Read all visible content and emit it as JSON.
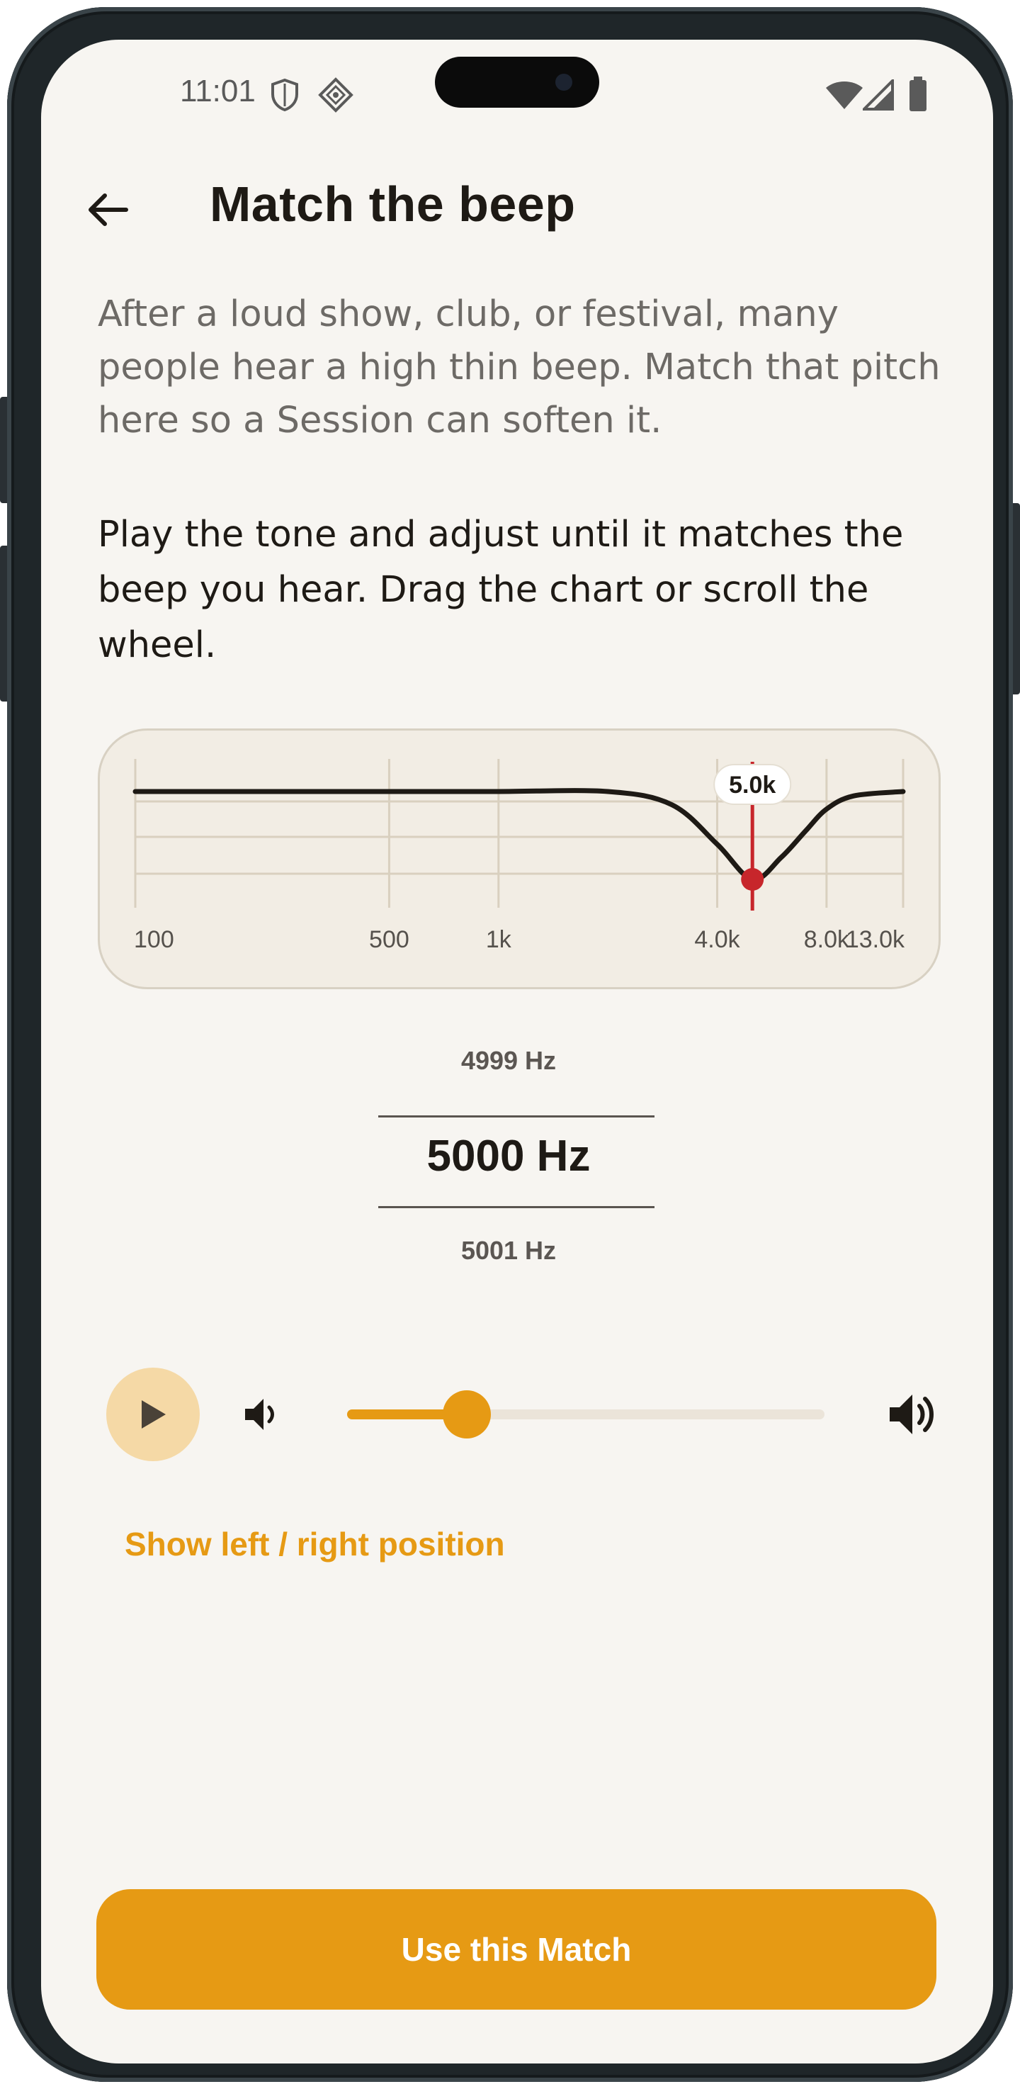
{
  "status_bar": {
    "time": "11:01",
    "icons": [
      "shield-icon",
      "location-diamond-icon",
      "wifi-icon",
      "signal-icon",
      "battery-icon"
    ]
  },
  "header": {
    "title": "Match the beep",
    "back_icon": "arrow-left-icon"
  },
  "intro_text": "After a loud show, club, or festival, many people hear a high thin beep. Match that pitch here so a Session can soften it.",
  "instructions_text": "Play the tone and adjust until it matches the beep you hear. Drag the chart or scroll the wheel.",
  "chart_data": {
    "type": "line",
    "x_scale": "log",
    "x_ticks": [
      100,
      500,
      1000,
      4000,
      8000,
      13000
    ],
    "tick_labels": [
      "100",
      "500",
      "1k",
      "4.0k",
      "8.0k",
      "13.0k"
    ],
    "xlim": [
      100,
      13000
    ],
    "selected_x": 5000,
    "selected_label": "5.0k",
    "curve": [
      {
        "x": 100,
        "y": 0
      },
      {
        "x": 500,
        "y": 0
      },
      {
        "x": 1000,
        "y": 0
      },
      {
        "x": 2000,
        "y": 0
      },
      {
        "x": 3000,
        "y": -0.15
      },
      {
        "x": 4000,
        "y": -0.6
      },
      {
        "x": 5000,
        "y": -1.0
      },
      {
        "x": 6000,
        "y": -0.75
      },
      {
        "x": 7000,
        "y": -0.45
      },
      {
        "x": 8000,
        "y": -0.2
      },
      {
        "x": 9500,
        "y": -0.05
      },
      {
        "x": 13000,
        "y": 0
      }
    ],
    "grid": true,
    "colors": {
      "curve": "#1e1a15",
      "marker": "#c7262b",
      "grid": "#d9d0bf"
    }
  },
  "wheel": {
    "prev": "4999 Hz",
    "current": "5000 Hz",
    "next": "5001 Hz"
  },
  "player": {
    "play_icon": "play-icon",
    "volume_low_icon": "volume-low-icon",
    "volume_high_icon": "volume-high-icon",
    "volume_fraction": 0.25
  },
  "link_label": "Show left / right position",
  "cta_label": "Use this Match",
  "colors": {
    "accent": "#e69a14",
    "background": "#f7f5f1",
    "text": "#1e1a15"
  }
}
